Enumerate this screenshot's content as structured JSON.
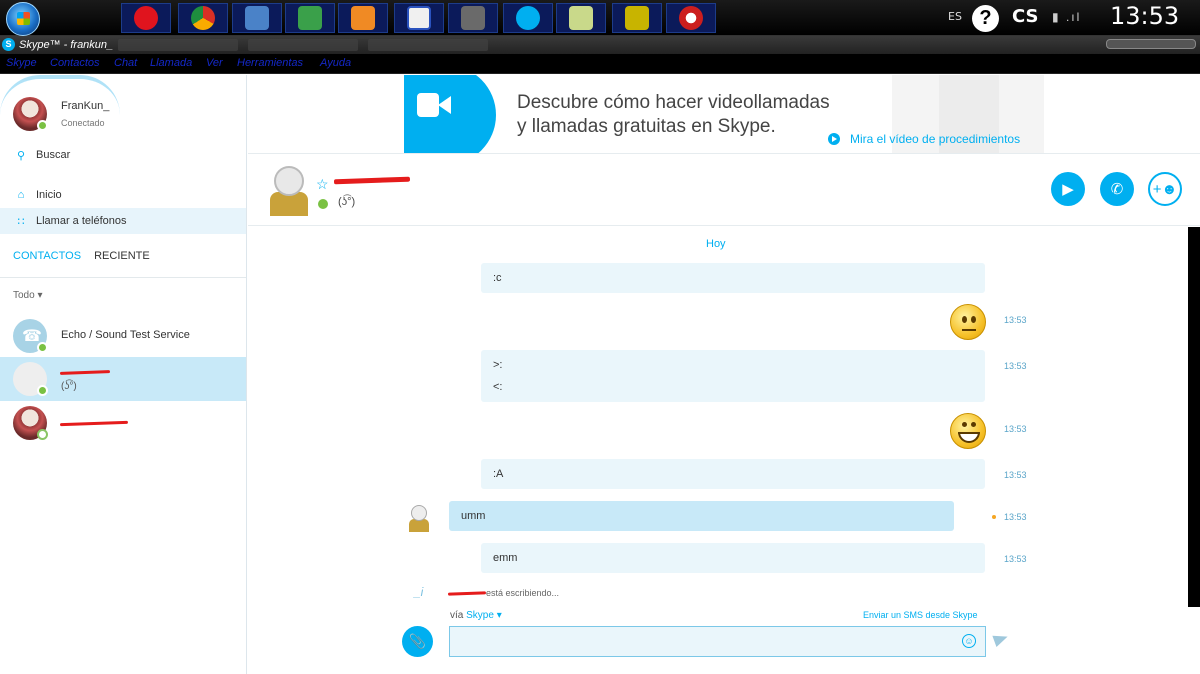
{
  "taskbar": {
    "apps": [
      {
        "icon": "opera-icon",
        "color": "#e0141e"
      },
      {
        "icon": "chrome-icon",
        "color": "#d9a31a"
      },
      {
        "icon": "notepad-icon",
        "color": "#4a82c8"
      },
      {
        "icon": "media-icon",
        "color": "#3aa04a"
      },
      {
        "icon": "player-icon",
        "color": "#f08a24"
      },
      {
        "icon": "window-icon",
        "color": "#f0f0f0"
      },
      {
        "icon": "camera-icon",
        "color": "#6a6a6a"
      },
      {
        "icon": "skype-icon",
        "color": "#00aff0"
      },
      {
        "icon": "note-icon",
        "color": "#c9d98a"
      },
      {
        "icon": "cube-icon",
        "color": "#c8b400"
      },
      {
        "icon": "record-icon",
        "color": "#cc1e1e"
      }
    ],
    "language": "ES",
    "help": "?",
    "cs_label": "CS",
    "clock": "13:53"
  },
  "window": {
    "title": "Skype™ - frankun_",
    "menu": [
      "Skype",
      "Contactos",
      "Chat",
      "Llamada",
      "Ver",
      "Herramientas",
      "Ayuda"
    ]
  },
  "me": {
    "name": "FranKun_",
    "status": "Conectado"
  },
  "sidebar": {
    "search_label": "Buscar",
    "nav": [
      {
        "icon": "home-icon",
        "label": "Inicio"
      },
      {
        "icon": "dialpad-icon",
        "label": "Llamar a teléfonos"
      }
    ],
    "tabs": [
      "CONTACTOS",
      "RECIENTE"
    ],
    "filter": "Todo",
    "contacts": [
      {
        "name": "Echo / Sound Test Service"
      },
      {
        "mood": "(ʖ͡°)"
      }
    ]
  },
  "banner": {
    "line1": "Descubre cómo hacer videollamadas",
    "line2": "y llamadas gratuitas en Skype.",
    "link": "Mira el vídeo de procedimientos"
  },
  "conversation": {
    "peer_mood": "(ʖ͡°)",
    "day": "Hoy",
    "messages": [
      {
        "lines": [
          ":c"
        ]
      },
      {
        "time": "13:53"
      },
      {
        "lines": [
          ">:",
          "<:"
        ],
        "time": "13:53"
      },
      {
        "time": "13:53"
      },
      {
        "lines": [
          ":A"
        ],
        "time": "13:53"
      },
      {
        "lines": [
          "umm"
        ],
        "time": "13:53"
      },
      {
        "lines": [
          "emm"
        ],
        "time": "13:53"
      }
    ],
    "typing": "está escribiendo...",
    "via_prefix": "vía",
    "via_link": "Skype",
    "sms_link": "Enviar un SMS desde Skype",
    "compose_placeholder": ""
  },
  "colors": {
    "accent": "#00aff0",
    "online": "#7ac143",
    "selected": "#c8e9f8"
  }
}
